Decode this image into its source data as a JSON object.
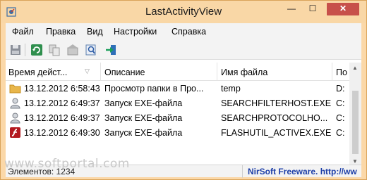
{
  "window": {
    "title": "LastActivityView",
    "minimize_label": "—",
    "maximize_label": "☐",
    "close_label": "✕"
  },
  "menu": [
    "Файл",
    "Правка",
    "Вид",
    "Настройки",
    "Справка"
  ],
  "toolbar": {
    "buttons": [
      "save-icon",
      "refresh-icon",
      "copy-icon",
      "properties-icon",
      "find-icon",
      "exit-icon"
    ]
  },
  "list": {
    "columns": [
      "Время дейст...",
      "Описание",
      "Имя файла",
      "По"
    ],
    "sort_indicator": "▽",
    "rows": [
      {
        "icon": "folder-icon",
        "time": "13.12.2012 6:58:43",
        "description": "Просмотр папки в Про...",
        "filename": "temp",
        "path": "D:"
      },
      {
        "icon": "user-icon",
        "time": "13.12.2012 6:49:37",
        "description": "Запуск EXE-файла",
        "filename": "SEARCHFILTERHOST.EXE",
        "path": "C:"
      },
      {
        "icon": "user-icon",
        "time": "13.12.2012 6:49:37",
        "description": "Запуск EXE-файла",
        "filename": "SEARCHPROTOCOLHO...",
        "path": "C:"
      },
      {
        "icon": "flash-icon",
        "time": "13.12.2012 6:49:30",
        "description": "Запуск EXE-файла",
        "filename": "FLASHUTIL_ACTIVEX.EXE",
        "path": "C:"
      }
    ]
  },
  "status": {
    "count": "Элементов: 1234",
    "link": "NirSoft Freeware.  http://ww"
  },
  "watermark": "www.softportal.com"
}
